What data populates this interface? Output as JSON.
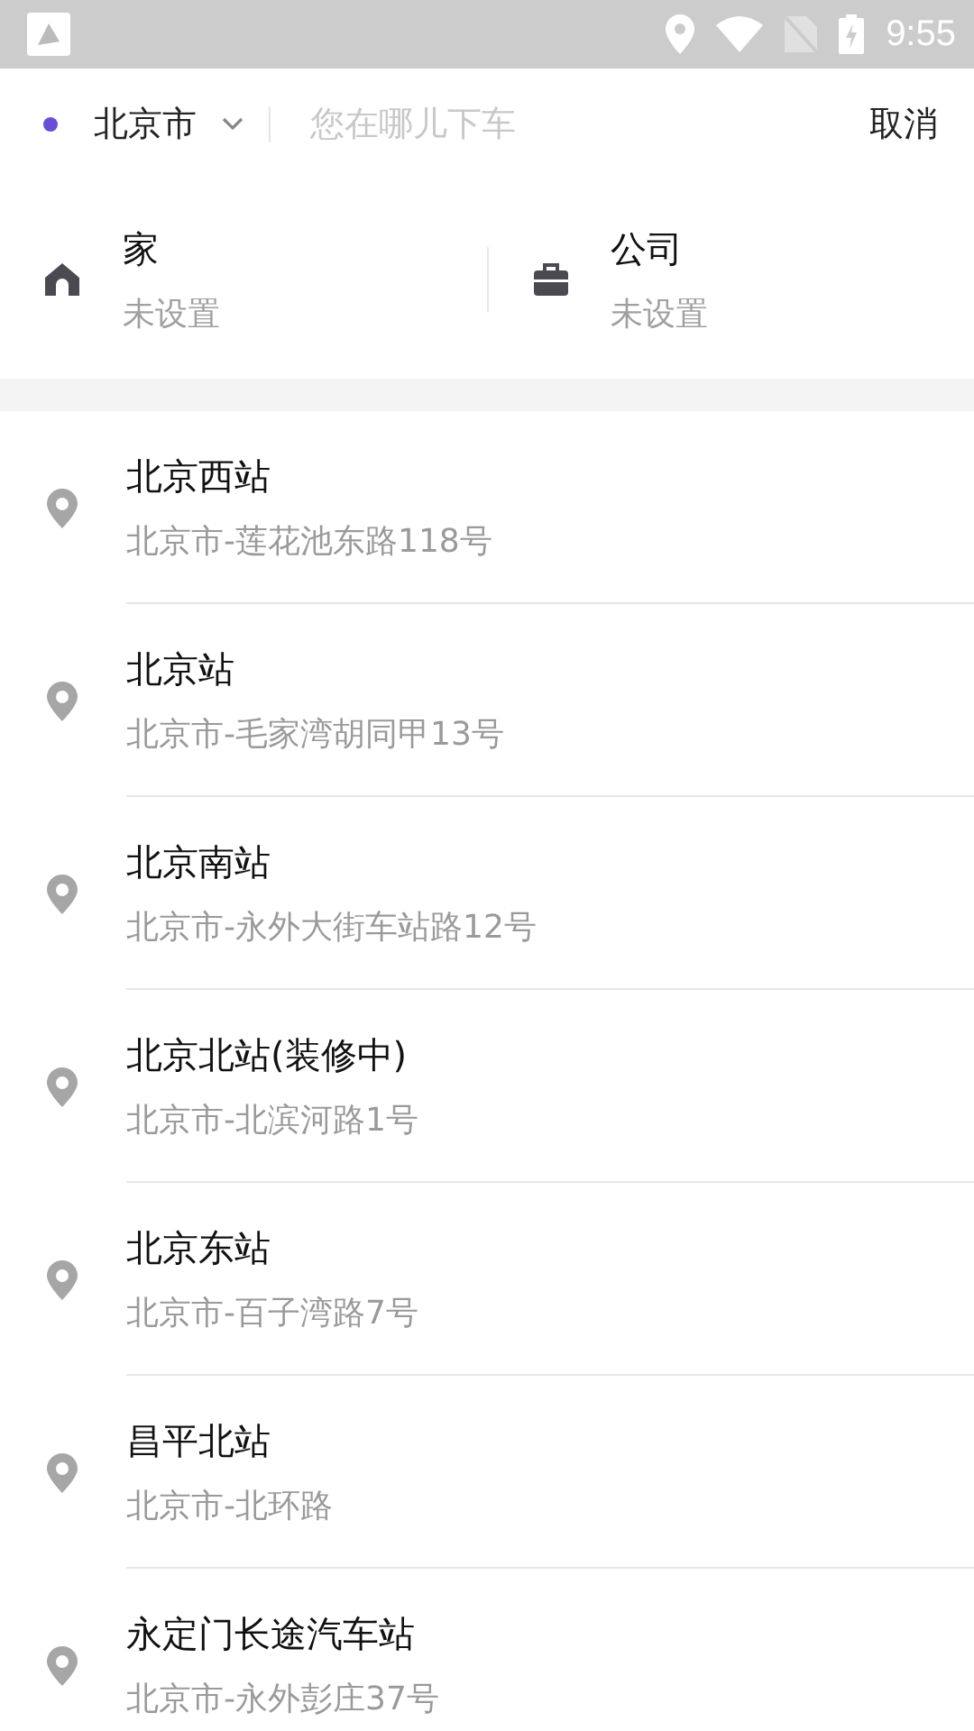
{
  "status_bar": {
    "time": "9:55"
  },
  "search_bar": {
    "city": "北京市",
    "placeholder": "您在哪儿下车",
    "cancel": "取消"
  },
  "shortcuts": [
    {
      "kind": "home",
      "label": "家",
      "value": "未设置"
    },
    {
      "kind": "work",
      "label": "公司",
      "value": "未设置"
    }
  ],
  "places": [
    {
      "name": "北京西站",
      "address": "北京市-莲花池东路118号"
    },
    {
      "name": "北京站",
      "address": "北京市-毛家湾胡同甲13号"
    },
    {
      "name": "北京南站",
      "address": "北京市-永外大街车站路12号"
    },
    {
      "name": "北京北站(装修中)",
      "address": "北京市-北滨河路1号"
    },
    {
      "name": "北京东站",
      "address": "北京市-百子湾路7号"
    },
    {
      "name": "昌平北站",
      "address": "北京市-北环路"
    },
    {
      "name": "永定门长途汽车站",
      "address": "北京市-永外彭庄37号"
    }
  ]
}
